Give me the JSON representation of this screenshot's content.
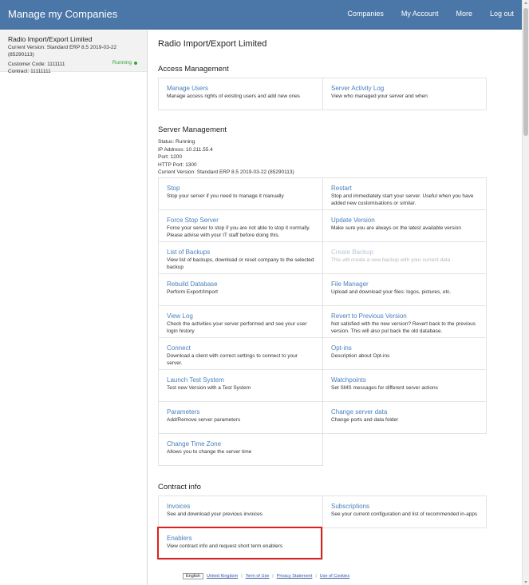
{
  "header": {
    "brand": "Manage my Companies",
    "nav": [
      "Companies",
      "My Account",
      "More",
      "Log out"
    ]
  },
  "sidebar": {
    "company": {
      "name": "Radio Import/Export Limited",
      "version": "Current Version: Standard ERP 8.5 2019-03-22 (85290113)",
      "customer_code": "Customer Code: 1111111",
      "contract": "Contract: 11111111",
      "status": "Running"
    }
  },
  "main": {
    "title": "Radio Import/Export Limited",
    "access_management": {
      "title": "Access Management",
      "items": [
        {
          "title": "Manage Users",
          "desc": "Manage access rights of existing users and add new ones"
        },
        {
          "title": "Server Activity Log",
          "desc": "View who managed your server and when"
        }
      ]
    },
    "server_management": {
      "title": "Server Management",
      "info": [
        "Status: Running",
        "IP Address: 10.211.55.4",
        "Port: 1200",
        "HTTP Port: 1300",
        "Current Version: Standard ERP 8.5 2019-03-22 (85290113)"
      ],
      "items": [
        {
          "title": "Stop",
          "desc": "Stop your server if you need to manage it manually"
        },
        {
          "title": "Restart",
          "desc": "Stop and immediately start your server. Useful when you have added new customisations or similar."
        },
        {
          "title": "Force Stop Server",
          "desc": "Force your server to stop if you are not able to stop it normally. Please advise with your IT staff before doing this."
        },
        {
          "title": "Update Version",
          "desc": "Make sure you are always on the latest available version"
        },
        {
          "title": "List of Backups",
          "desc": "View list of backups, download or reset company to the selected backup"
        },
        {
          "title": "Create Backup",
          "desc": "This will create a new backup with your current data.",
          "disabled": true
        },
        {
          "title": "Rebuild Database",
          "desc": "Perform Export/Import"
        },
        {
          "title": "File Manager",
          "desc": "Upload and download your files: logos, pictures, etc."
        },
        {
          "title": "View Log",
          "desc": "Check the activities your server performed and see your user login history"
        },
        {
          "title": "Revert to Previous Version",
          "desc": "Not satisfied with the new version? Revert back to the previous version. This will also put back the old database."
        },
        {
          "title": "Connect",
          "desc": "Download a client with correct settings to connect to your server."
        },
        {
          "title": "Opt-ins",
          "desc": "Description about Opt-ins"
        },
        {
          "title": "Launch Test System",
          "desc": "Test new Version with a Test System"
        },
        {
          "title": "Watchpoints",
          "desc": "Set SMS messages for different server actions"
        },
        {
          "title": "Parameters",
          "desc": "Add/Remove server parameters"
        },
        {
          "title": "Change server data",
          "desc": "Change ports and data folder"
        },
        {
          "title": "Change Time Zone",
          "desc": "Allows you to change the server time"
        }
      ]
    },
    "contract_info": {
      "title": "Contract info",
      "items": [
        {
          "title": "Invoices",
          "desc": "See and download your previous invoices"
        },
        {
          "title": "Subscriptions",
          "desc": "See your current configuration and list of recommended in-apps"
        },
        {
          "title": "Enablers",
          "desc": "View contract info and request short term enablers"
        }
      ]
    }
  },
  "footer": {
    "language": "English",
    "links": [
      "United Kingdom",
      "Term of Use",
      "Privacy Statement",
      "Use of Cookies"
    ]
  },
  "colors": {
    "header_bg": "#4a76a8",
    "link": "#4a80bd",
    "status_running": "#3aa53a",
    "highlight": "#e01e1e"
  }
}
